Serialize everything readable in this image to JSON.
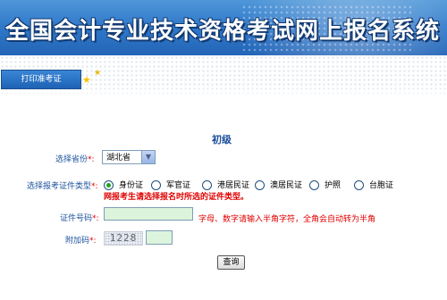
{
  "header": {
    "title": "全国会计专业技术资格考试网上报名系统",
    "tab_label": "打印准考证"
  },
  "form": {
    "level_title": "初级",
    "province": {
      "label": "选择省份",
      "required_mark": "*:",
      "value": "湖北省"
    },
    "id_type": {
      "label": "选择报考证件类型",
      "required_mark": "*:",
      "options": [
        "身份证",
        "军官证",
        "港居民证",
        "澳居民证",
        "护照",
        "台胞证"
      ],
      "selected": "身份证",
      "warning": "网报考生请选择报名时所选的证件类型。"
    },
    "id_number": {
      "label": "证件号码",
      "required_mark": "*:",
      "value": "",
      "hint": "字母、数字请输入半角字符，全角会自动转为半角"
    },
    "captcha": {
      "label": "附加码",
      "required_mark": "*:",
      "image_text": "1228",
      "value": ""
    },
    "submit_label": "查询"
  },
  "colors": {
    "banner": "#2f78c9",
    "tab": "#1e62b4",
    "label": "#1f55a0",
    "required": "#e00000",
    "input_bg": "#dcf4dc"
  }
}
